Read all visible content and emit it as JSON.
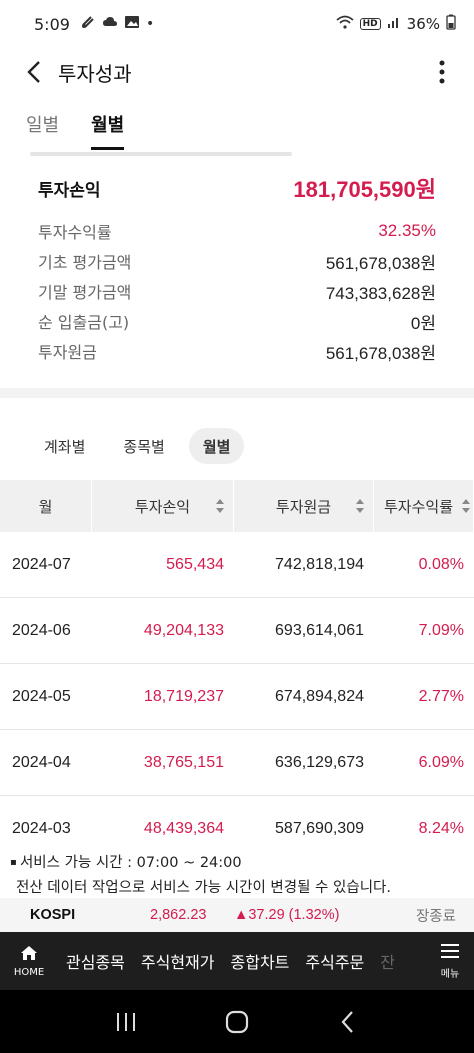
{
  "status_bar": {
    "time": "5:09",
    "hd": "HD",
    "battery": "36%"
  },
  "app_bar": {
    "title": "투자성과"
  },
  "tabs": [
    {
      "label": "일별",
      "active": false
    },
    {
      "label": "월별",
      "active": true
    }
  ],
  "summary": {
    "profit_label": "투자손익",
    "profit_value": "181,705,590원",
    "rows": [
      {
        "label": "투자수익률",
        "value": "32.35%"
      },
      {
        "label": "기초 평가금액",
        "value": "561,678,038원"
      },
      {
        "label": "기말 평가금액",
        "value": "743,383,628원"
      },
      {
        "label": "순 입출금(고)",
        "value": "0원"
      },
      {
        "label": "투자원금",
        "value": "561,678,038원"
      }
    ]
  },
  "segments": [
    {
      "label": "계좌별",
      "active": false
    },
    {
      "label": "종목별",
      "active": false
    },
    {
      "label": "월별",
      "active": true
    }
  ],
  "table": {
    "headers": [
      "월",
      "투자손익",
      "투자원금",
      "투자수익률"
    ],
    "rows": [
      {
        "month": "2024-07",
        "profit": "565,434",
        "principal": "742,818,194",
        "rate": "0.08%"
      },
      {
        "month": "2024-06",
        "profit": "49,204,133",
        "principal": "693,614,061",
        "rate": "7.09%"
      },
      {
        "month": "2024-05",
        "profit": "18,719,237",
        "principal": "674,894,824",
        "rate": "2.77%"
      },
      {
        "month": "2024-04",
        "profit": "38,765,151",
        "principal": "636,129,673",
        "rate": "6.09%"
      },
      {
        "month": "2024-03",
        "profit": "48,439,364",
        "principal": "587,690,309",
        "rate": "8.24%"
      }
    ]
  },
  "notice": {
    "line1": "서비스 가능 시간 : 07:00 ~ 24:00",
    "line2": "전산 데이터 작업으로 서비스 가능 시간이 변경될 수 있습니다."
  },
  "ticker": {
    "name": "KOSPI",
    "price": "2,862.23",
    "change": "▲37.29 (1.32%)",
    "status": "장종료"
  },
  "bottom_nav": {
    "home_label": "HOME",
    "items": [
      "관심종목",
      "주식현재가",
      "종합차트",
      "주식주문",
      "잔"
    ],
    "menu_label": "메뉴"
  },
  "colors": {
    "accent_red": "#d41c4f",
    "nav_bg": "#1e1e1e"
  }
}
